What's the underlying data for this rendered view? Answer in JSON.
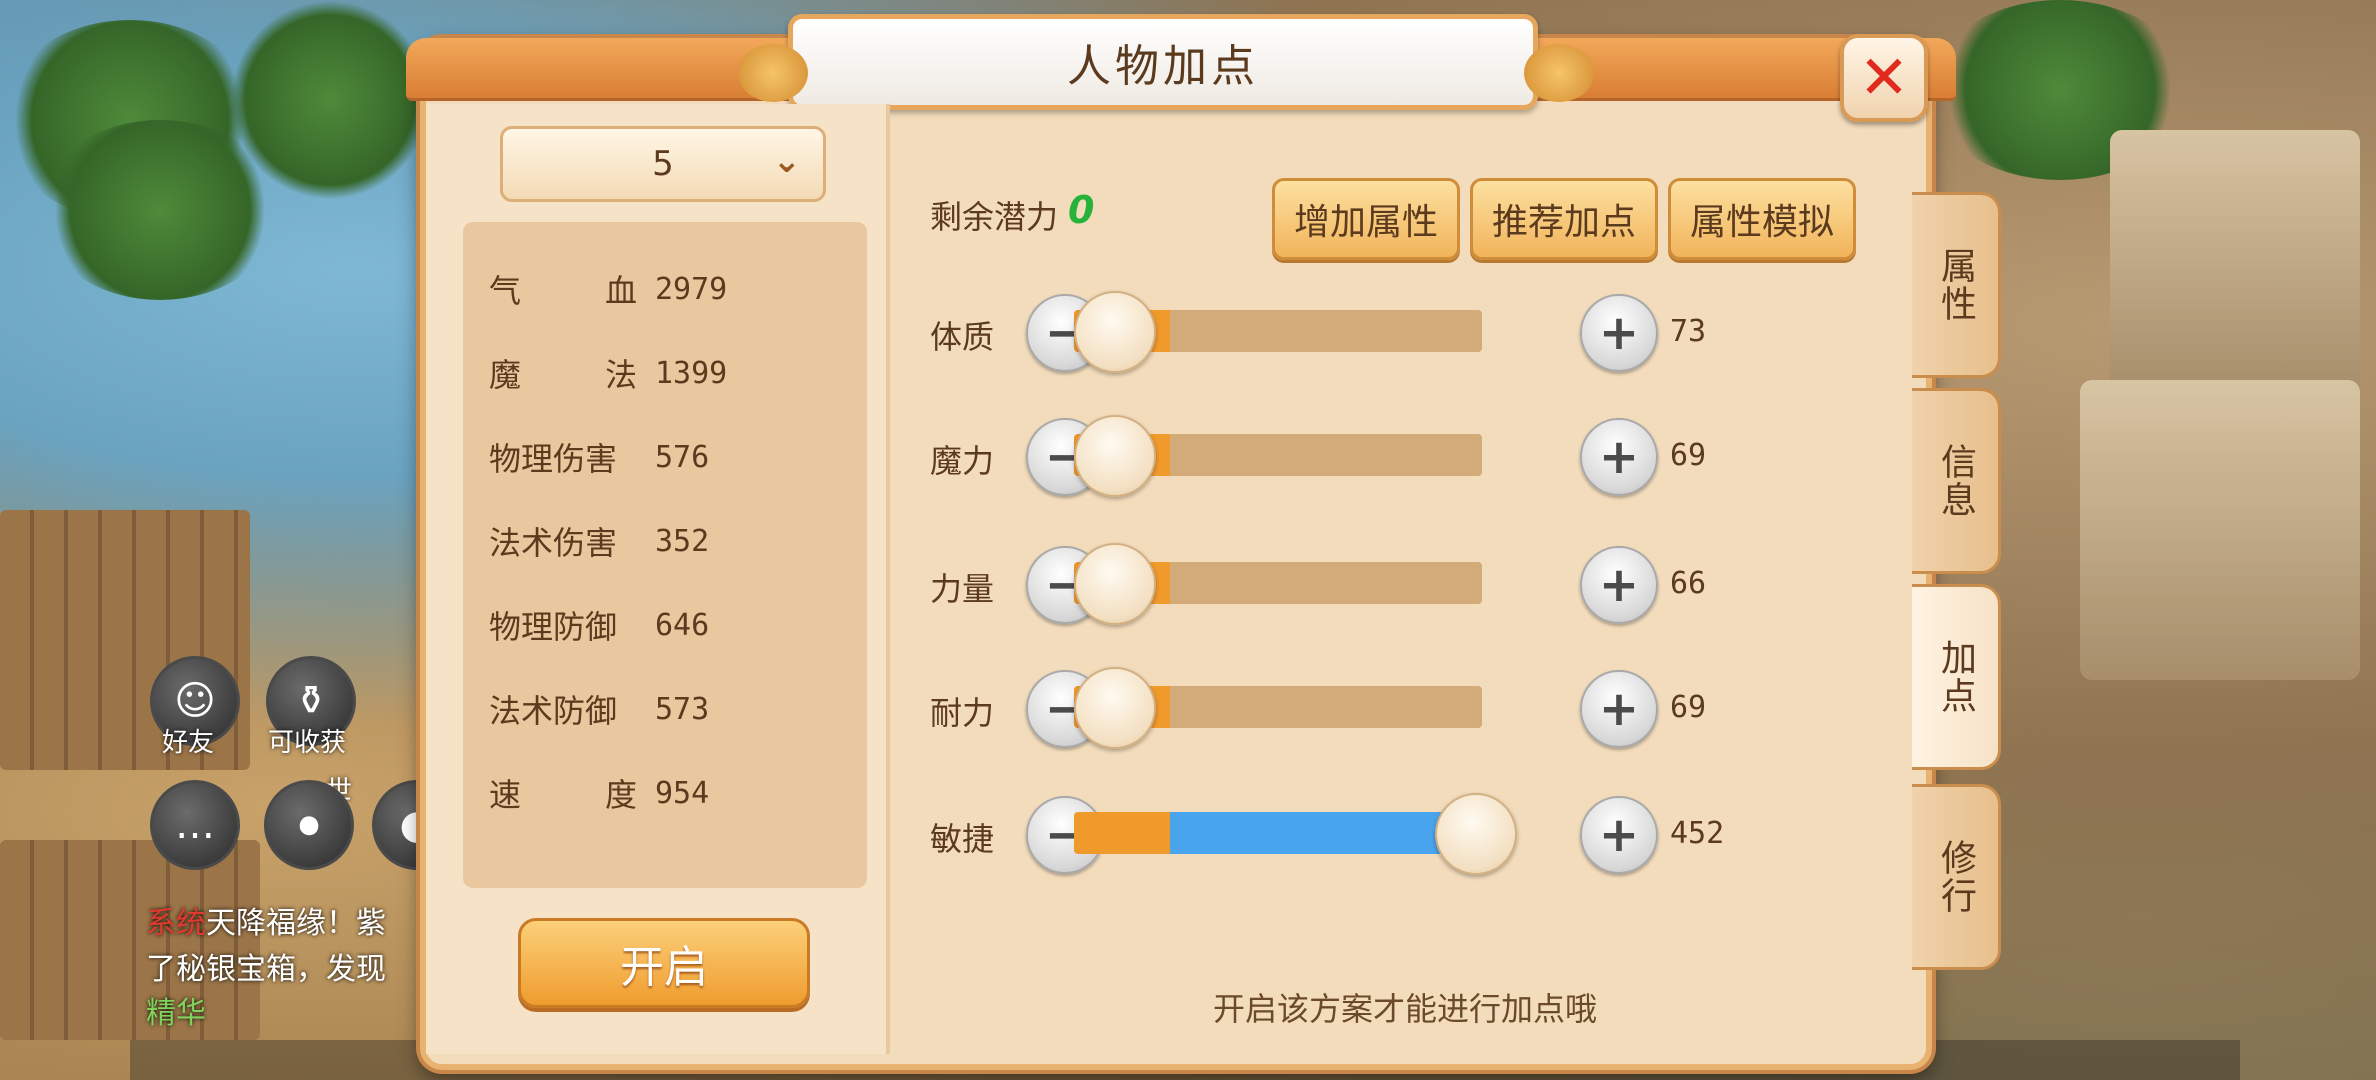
{
  "dialog": {
    "title": "人物加点",
    "plan_select": {
      "value": "5"
    },
    "stats": [
      {
        "name": "气血",
        "value": "2979"
      },
      {
        "name": "魔法",
        "value": "1399"
      },
      {
        "name": "物理伤害",
        "value": "576"
      },
      {
        "name": "法术伤害",
        "value": "352"
      },
      {
        "name": "物理防御",
        "value": "646"
      },
      {
        "name": "法术防御",
        "value": "573"
      },
      {
        "name": "速度",
        "value": "954"
      }
    ],
    "open_button": "开启",
    "potential_label": "剩余潜力",
    "potential_value": "0",
    "actions": [
      "增加属性",
      "推荐加点",
      "属性模拟"
    ],
    "attributes": [
      {
        "name": "体质",
        "value": "73",
        "level": 0.07
      },
      {
        "name": "魔力",
        "value": "69",
        "level": 0.06
      },
      {
        "name": "力量",
        "value": "66",
        "level": 0.05
      },
      {
        "name": "耐力",
        "value": "69",
        "level": 0.06
      },
      {
        "name": "敏捷",
        "value": "452",
        "level": 0.98
      }
    ],
    "hint": "开启该方案才能进行加点哦",
    "side_tabs": [
      "属性",
      "信息",
      "加点",
      "修行"
    ],
    "active_tab": "加点"
  },
  "hud": {
    "friends_label": "好友",
    "harvest_label": "可收获",
    "world_label": "世",
    "chat": {
      "channel": "系统",
      "line1": "天降福缘！紫",
      "line2": "了秘银宝箱，发现",
      "line3": "精华"
    }
  },
  "colors": {
    "accent_orange": "#f19a2c",
    "slider_blue": "#49a4ee",
    "potential_green": "#27b23a",
    "close_red": "#e02a1e"
  }
}
